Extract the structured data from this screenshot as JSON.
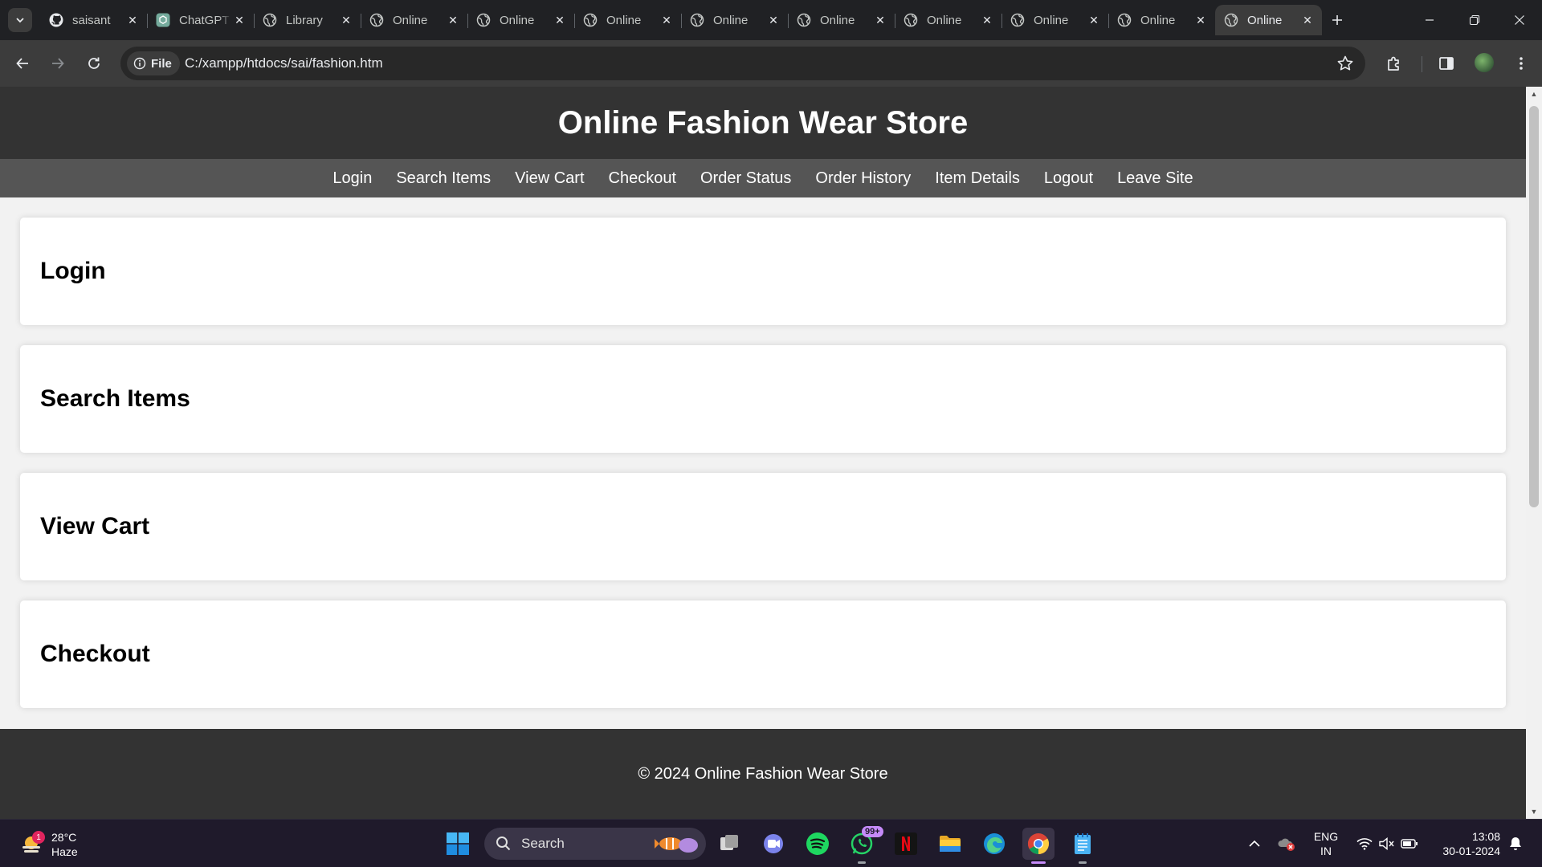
{
  "browser": {
    "tabs": [
      {
        "title": "saisant",
        "icon": "github-icon",
        "active": false
      },
      {
        "title": "ChatGPT",
        "icon": "chatgpt-icon",
        "active": false
      },
      {
        "title": "Library",
        "icon": "globe-icon",
        "active": false
      },
      {
        "title": "Online",
        "icon": "globe-icon",
        "active": false
      },
      {
        "title": "Online",
        "icon": "globe-icon",
        "active": false
      },
      {
        "title": "Online",
        "icon": "globe-icon",
        "active": false
      },
      {
        "title": "Online",
        "icon": "globe-icon",
        "active": false
      },
      {
        "title": "Online",
        "icon": "globe-icon",
        "active": false
      },
      {
        "title": "Online",
        "icon": "globe-icon",
        "active": false
      },
      {
        "title": "Online",
        "icon": "globe-icon",
        "active": false
      },
      {
        "title": "Online",
        "icon": "globe-icon",
        "active": false
      },
      {
        "title": "Online",
        "icon": "globe-icon",
        "active": true
      }
    ],
    "site_info_label": "File",
    "url": "C:/xampp/htdocs/sai/fashion.htm"
  },
  "page": {
    "title": "Online Fashion Wear Store",
    "nav": [
      "Login",
      "Search Items",
      "View Cart",
      "Checkout",
      "Order Status",
      "Order History",
      "Item Details",
      "Logout",
      "Leave Site"
    ],
    "sections": [
      "Login",
      "Search Items",
      "View Cart",
      "Checkout"
    ],
    "footer": "© 2024 Online Fashion Wear Store"
  },
  "taskbar": {
    "weather": {
      "temp": "28°C",
      "condition": "Haze",
      "badge": "1"
    },
    "search_label": "Search",
    "whatsapp_badge": "99+",
    "language": "ENG",
    "region": "IN",
    "time": "13:08",
    "date": "30-01-2024"
  },
  "colors": {
    "header_bg": "#333333",
    "nav_bg": "#555555",
    "page_bg": "#f2f2f2",
    "card_bg": "#ffffff",
    "chrome_dark": "#202124",
    "chrome_toolbar": "#3c3c3c"
  }
}
